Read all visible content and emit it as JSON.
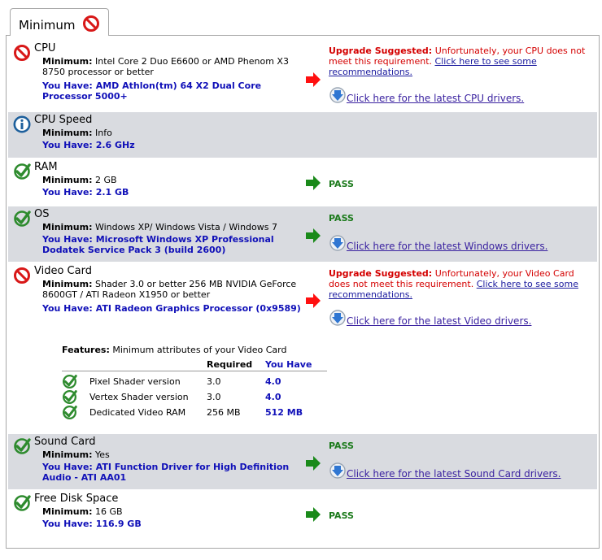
{
  "tab": {
    "label": "Minimum",
    "icon": "no-entry-icon"
  },
  "colors": {
    "pass": "#1b7a1b",
    "fail": "#d40000",
    "have": "#1010b8",
    "row_shade": "#d9dbe0",
    "link": "#1a1a9e"
  },
  "labels": {
    "minimum": "Minimum:",
    "you_have": "You Have:",
    "pass": "PASS",
    "upgrade": "Upgrade Suggested:"
  },
  "cpu": {
    "title": "CPU",
    "status_icon": "no-entry-icon",
    "minimum": "Intel Core 2 Duo E6600 or AMD Phenom X3 8750 processor or better",
    "you_have": "AMD Athlon(tm) 64 X2 Dual Core Processor 5000+",
    "upgrade_text": "Unfortunately, your CPU does not meet this requirement.",
    "recommend_link": "Click here to see some recommendations.",
    "driver_link": "Click here for the latest CPU drivers."
  },
  "cpu_speed": {
    "title": "CPU Speed",
    "status_icon": "info-icon",
    "minimum": "Info",
    "you_have": "2.6 GHz"
  },
  "ram": {
    "title": "RAM",
    "status_icon": "check-icon",
    "minimum": "2 GB",
    "you_have": "2.1 GB"
  },
  "os": {
    "title": "OS",
    "status_icon": "check-icon",
    "minimum": "Windows XP/ Windows Vista / Windows 7",
    "you_have": "Microsoft Windows XP Professional Dodatek Service Pack 3 (build 2600)",
    "driver_link": "Click here for the latest Windows drivers."
  },
  "video": {
    "title": "Video Card",
    "status_icon": "no-entry-icon",
    "minimum": "Shader 3.0 or better 256 MB NVIDIA GeForce 8600GT / ATI Radeon X1950 or better",
    "you_have": "ATI Radeon Graphics Processor (0x9589)",
    "upgrade_text": "Unfortunately, your Video Card does not meet this requirement.",
    "recommend_link": "Click here to see some recommendations.",
    "driver_link": "Click here for the latest Video drivers.",
    "features_label": "Features:",
    "features_text": "Minimum attributes of your Video Card",
    "col_required": "Required",
    "col_you_have": "You Have",
    "features": [
      {
        "name": "Pixel Shader version",
        "required": "3.0",
        "have": "4.0"
      },
      {
        "name": "Vertex Shader version",
        "required": "3.0",
        "have": "4.0"
      },
      {
        "name": "Dedicated Video RAM",
        "required": "256 MB",
        "have": "512 MB"
      }
    ]
  },
  "sound": {
    "title": "Sound Card",
    "status_icon": "check-icon",
    "minimum": "Yes",
    "you_have": "ATI Function Driver for High Definition Audio - ATI AA01",
    "driver_link": "Click here for the latest Sound Card drivers."
  },
  "disk": {
    "title": "Free Disk Space",
    "status_icon": "check-icon",
    "minimum": "16 GB",
    "you_have": "116.9 GB"
  }
}
